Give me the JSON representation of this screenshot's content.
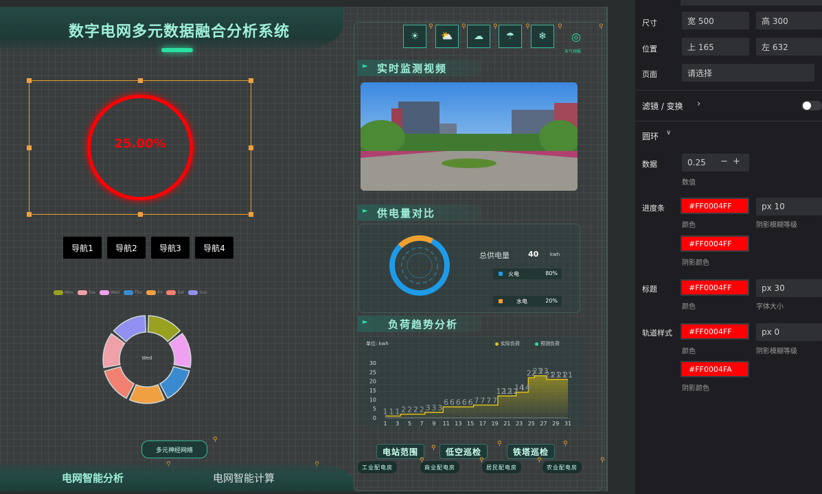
{
  "screen": {
    "title": "数字电网多元数据融合分析系统",
    "weather_label": "天气预报",
    "gauge": {
      "percent_text": "25.00%",
      "value": 0.25,
      "color": "#FF0004"
    },
    "nav_buttons": [
      "导航1",
      "导航2",
      "导航3",
      "导航4"
    ],
    "legend": [
      "Mon",
      "Tue",
      "Wed",
      "Thu",
      "Fri",
      "Sat",
      "Sun"
    ],
    "legend_colors": [
      "#9aa020",
      "#f0a0a8",
      "#f0a0f0",
      "#3a8ad0",
      "#f0a040",
      "#f08070",
      "#9090f0"
    ],
    "donut_label": "Wed",
    "net_button": "多元神经网络",
    "bottom_tabs": {
      "left": "电网智能分析",
      "right": "电网智能计算"
    },
    "sections": {
      "video": "实时监测视频",
      "supply": "供电量对比",
      "trend": "负荷趋势分析"
    },
    "supply": {
      "total_label": "总供电量",
      "total_value": "40",
      "unit": "kwh",
      "rows": [
        {
          "name": "火电",
          "percent": "80%",
          "color": "#1e9be8"
        },
        {
          "name": "水电",
          "percent": "20%",
          "color": "#f0a030"
        }
      ]
    },
    "trend": {
      "unit_label": "单位: kwh",
      "legend_actual": "实际负荷",
      "legend_forecast": "预测负荷"
    },
    "action_buttons": [
      "电站范围",
      "低空巡检",
      "铁塔巡检"
    ],
    "station_buttons": [
      "工业配电房",
      "商业配电房",
      "居民配电房",
      "农业配电房"
    ]
  },
  "chart_data": {
    "type": "area",
    "title": "负荷趋势分析",
    "ylabel": "单位: kwh",
    "x": [
      1,
      2,
      3,
      4,
      5,
      6,
      7,
      8,
      9,
      10,
      11,
      12,
      13,
      14,
      15,
      16,
      17,
      18,
      19,
      20,
      21,
      22,
      23,
      24,
      25,
      26,
      27,
      28,
      29,
      30,
      31
    ],
    "x_ticks": [
      "1",
      "3",
      "5",
      "7",
      "9",
      "11",
      "13",
      "15",
      "17",
      "19",
      "21",
      "23",
      "25",
      "27",
      "29",
      "31"
    ],
    "ylim": [
      0,
      30
    ],
    "y_ticks": [
      "0",
      "5",
      "10",
      "15",
      "20",
      "25",
      "30"
    ],
    "series": [
      {
        "name": "实际负荷",
        "color": "#e0c020",
        "values": [
          1,
          1,
          1,
          2,
          2,
          2,
          2,
          3,
          3,
          3,
          6,
          6,
          6,
          6,
          6,
          7,
          7,
          7,
          7,
          12,
          12,
          12,
          14,
          14,
          22,
          23,
          23,
          21,
          21,
          21,
          21
        ]
      }
    ],
    "data_labels": [
      "1",
      "1",
      "1",
      "2",
      "2",
      "2",
      "2",
      "3",
      "3",
      "3",
      "6",
      "6",
      "6",
      "6",
      "6",
      "7",
      "7",
      "7",
      "7",
      "12",
      "12",
      "12",
      "14",
      "14",
      "22",
      "23",
      "23",
      "21",
      "21",
      "21",
      "21"
    ],
    "grid": false,
    "legend_position": "top-right"
  },
  "panel": {
    "size_label": "尺寸",
    "width_value": "宽 500",
    "height_value": "高 300",
    "pos_label": "位置",
    "top_value": "上 165",
    "left_value": "左 632",
    "page_label": "页面",
    "page_value": "请选择",
    "filter_label": "滤镜 / 变换",
    "ring_label": "圆环",
    "data_label": "数据",
    "data_value": "0.25",
    "data_sub": "数值",
    "progress_label": "进度条",
    "color_text": "#FF0004FF",
    "blur_value": "px 10",
    "color_sub": "颜色",
    "blur_sub": "阴影模糊等级",
    "shadow_color_text": "#FF0004FF",
    "shadow_color_sub": "阴影颜色",
    "title_label": "标题",
    "title_color_text": "#FF0004FF",
    "font_size_value": "px 30",
    "title_color_sub": "颜色",
    "font_size_sub": "字体大小",
    "track_label": "轨道样式",
    "track_color_text": "#FF0004FF",
    "track_blur_value": "px 0",
    "track_color_sub": "颜色",
    "track_blur_sub": "阴影模糊等级",
    "track_shadow_text": "#FF0004FA",
    "track_shadow_sub": "阴影颜色"
  }
}
